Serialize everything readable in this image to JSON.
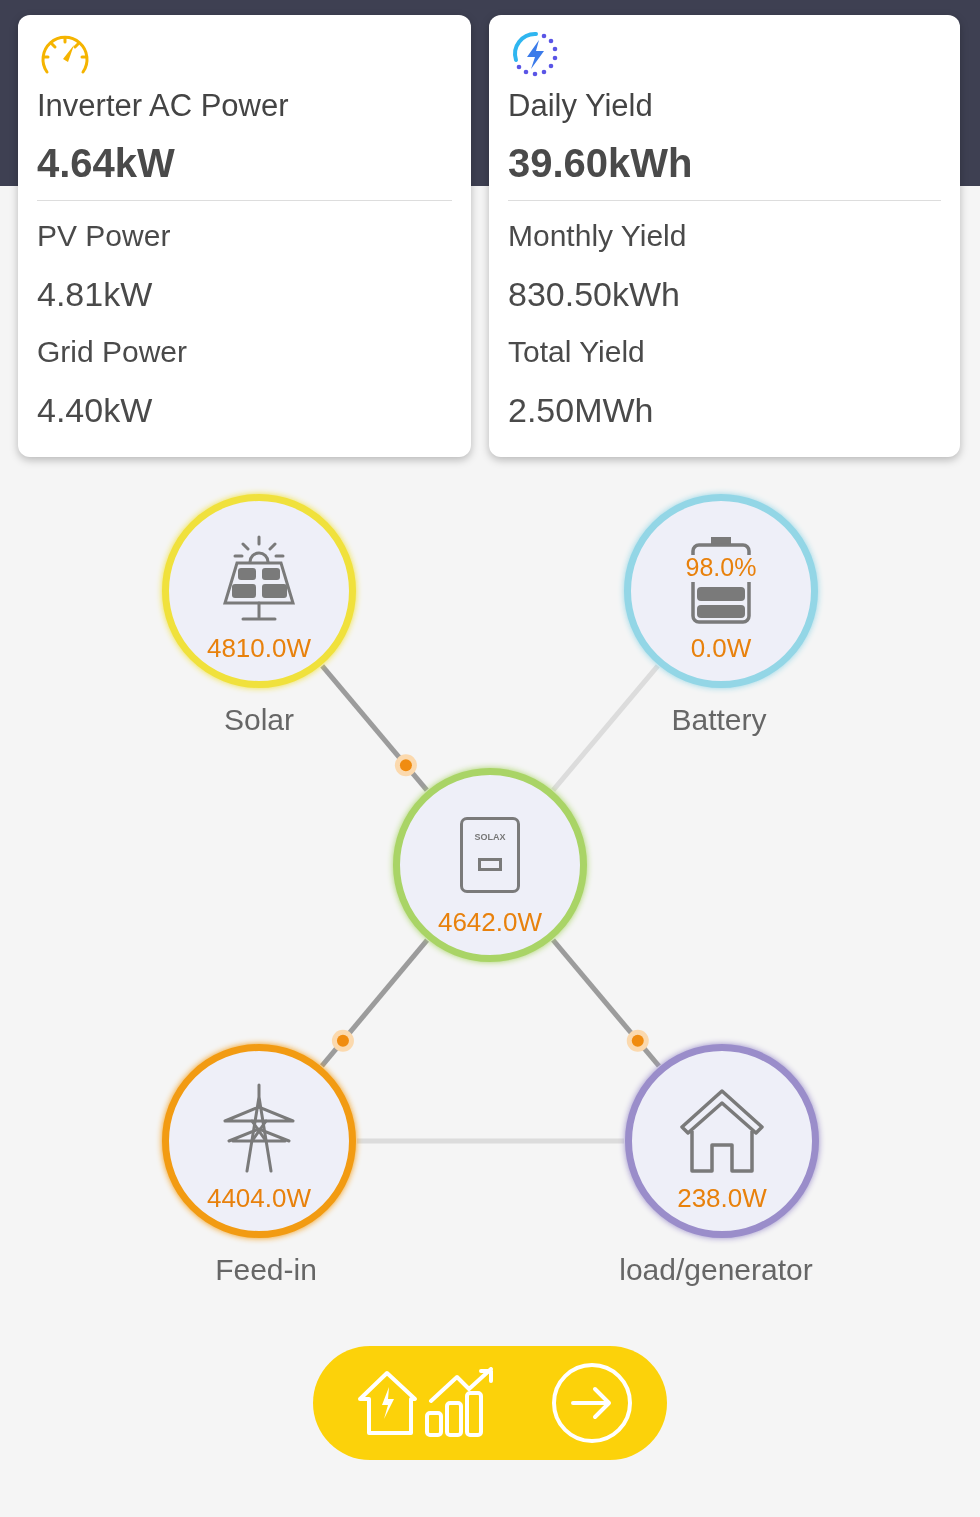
{
  "cards": [
    {
      "kind": "gauge",
      "title": "Inverter AC Power",
      "value": "4.64kW",
      "rows": [
        {
          "label": "PV Power",
          "value": "4.81kW"
        },
        {
          "label": "Grid Power",
          "value": "4.40kW"
        }
      ]
    },
    {
      "kind": "bolt",
      "title": "Daily Yield",
      "value": "39.60kWh",
      "rows": [
        {
          "label": "Monthly Yield",
          "value": "830.50kWh"
        },
        {
          "label": "Total Yield",
          "value": "2.50MWh"
        }
      ]
    }
  ],
  "flow": {
    "nodes": [
      {
        "kind": "solar",
        "label": "Solar",
        "power": "4810.0W",
        "color": "#f0e13c"
      },
      {
        "kind": "battery",
        "label": "Battery",
        "power": "0.0W",
        "percent": "98.0%",
        "color": "#93d6e6"
      },
      {
        "kind": "inverter",
        "power": "4642.0W",
        "brand": "SOLAX",
        "color": "#a9d466"
      },
      {
        "kind": "grid",
        "label": "Feed-in",
        "power": "4404.0W",
        "color": "#f29b12"
      },
      {
        "kind": "load",
        "label": "load/generator",
        "power": "238.0W",
        "color": "#9a8dca"
      }
    ],
    "connections": [
      {
        "flowing": true
      },
      {
        "flowing": false
      },
      {
        "flowing": true
      },
      {
        "flowing": true
      },
      {
        "flowing": false
      }
    ]
  }
}
